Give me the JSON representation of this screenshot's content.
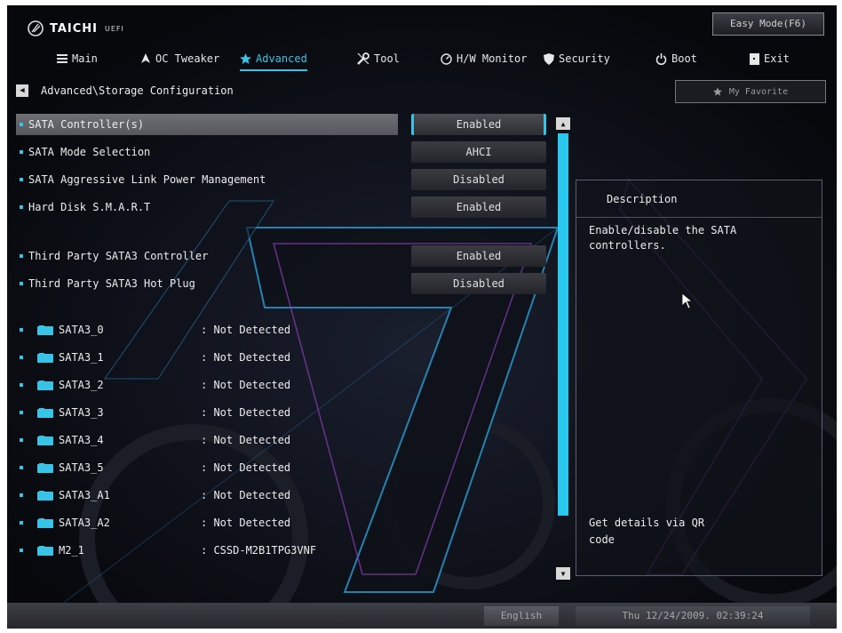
{
  "brand": {
    "name": "TAICHI",
    "suffix": "UEFI"
  },
  "easy_mode_label": "Easy Mode(F6)",
  "nav": [
    {
      "label": "Main",
      "icon": "list-icon"
    },
    {
      "label": "OC Tweaker",
      "icon": "rocket-icon"
    },
    {
      "label": "Advanced",
      "icon": "star-icon",
      "active": true
    },
    {
      "label": "Tool",
      "icon": "tool-icon"
    },
    {
      "label": "H/W Monitor",
      "icon": "monitor-gauge-icon"
    },
    {
      "label": "Security",
      "icon": "shield-icon"
    },
    {
      "label": "Boot",
      "icon": "power-icon"
    },
    {
      "label": "Exit",
      "icon": "exit-icon"
    }
  ],
  "breadcrumb": "Advanced\\Storage Configuration",
  "favorite_label": "My Favorite",
  "settings": [
    {
      "label": "SATA Controller(s)",
      "value": "Enabled",
      "selected": true
    },
    {
      "label": "SATA Mode Selection",
      "value": "AHCI"
    },
    {
      "label": "SATA Aggressive Link Power Management",
      "value": "Disabled"
    },
    {
      "label": "Hard Disk S.M.A.R.T",
      "value": "Enabled"
    },
    {
      "label": "Third Party SATA3 Controller",
      "value": "Enabled"
    },
    {
      "label": "Third Party SATA3 Hot Plug",
      "value": "Disabled"
    }
  ],
  "disks": [
    {
      "name": "SATA3_0",
      "status": ": Not Detected"
    },
    {
      "name": "SATA3_1",
      "status": ": Not Detected"
    },
    {
      "name": "SATA3_2",
      "status": ": Not Detected"
    },
    {
      "name": "SATA3_3",
      "status": ": Not Detected"
    },
    {
      "name": "SATA3_4",
      "status": ": Not Detected"
    },
    {
      "name": "SATA3_5",
      "status": ": Not Detected"
    },
    {
      "name": "SATA3_A1",
      "status": ": Not Detected"
    },
    {
      "name": "SATA3_A2",
      "status": ": Not Detected"
    },
    {
      "name": "M2_1",
      "status": ": CSSD-M2B1TPG3VNF"
    }
  ],
  "description": {
    "title": "Description",
    "text": "Enable/disable the SATA controllers.",
    "qr_text": "Get details via QR code"
  },
  "status_bar": {
    "language": "English",
    "datetime": "Thu 12/24/2009. 02:39:24"
  },
  "colors": {
    "accent": "#29c6ee",
    "background": "#0b0d12",
    "panel_border": "#5a5f6e"
  }
}
